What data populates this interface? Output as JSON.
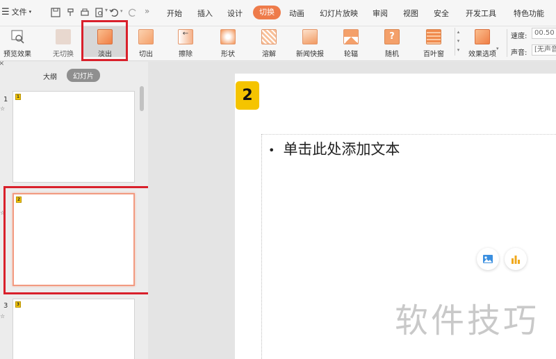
{
  "menu": {
    "file_label": "文件",
    "tabs": [
      "开始",
      "插入",
      "设计",
      "切换",
      "动画",
      "幻灯片放映",
      "审阅",
      "视图",
      "安全",
      "开发工具",
      "特色功能"
    ],
    "active_tab": "切换"
  },
  "ribbon": {
    "preview_label": "预览效果",
    "transitions": [
      "无切换",
      "淡出",
      "切出",
      "擦除",
      "形状",
      "溶解",
      "新闻快报",
      "轮辐",
      "随机",
      "百叶窗"
    ],
    "selected_transition": "淡出",
    "effect_options_label": "效果选项",
    "speed_label": "速度:",
    "speed_value": "00.50",
    "sound_label": "声音:",
    "sound_value": "[无声音]"
  },
  "left_panel": {
    "outline_tab": "大纲",
    "slides_tab": "幻灯片",
    "slides": [
      {
        "number": "1",
        "badge": "1"
      },
      {
        "number": "",
        "badge": "2"
      },
      {
        "number": "3",
        "badge": "3"
      }
    ],
    "star": "☆"
  },
  "editor": {
    "slide_badge": "2",
    "bullet": "•",
    "placeholder_text": "单击此处添加文本",
    "watermark": "软件技巧"
  },
  "colors": {
    "accent": "#ee7b4a",
    "highlight_box": "#d9202b",
    "badge_yellow": "#f5c400"
  }
}
